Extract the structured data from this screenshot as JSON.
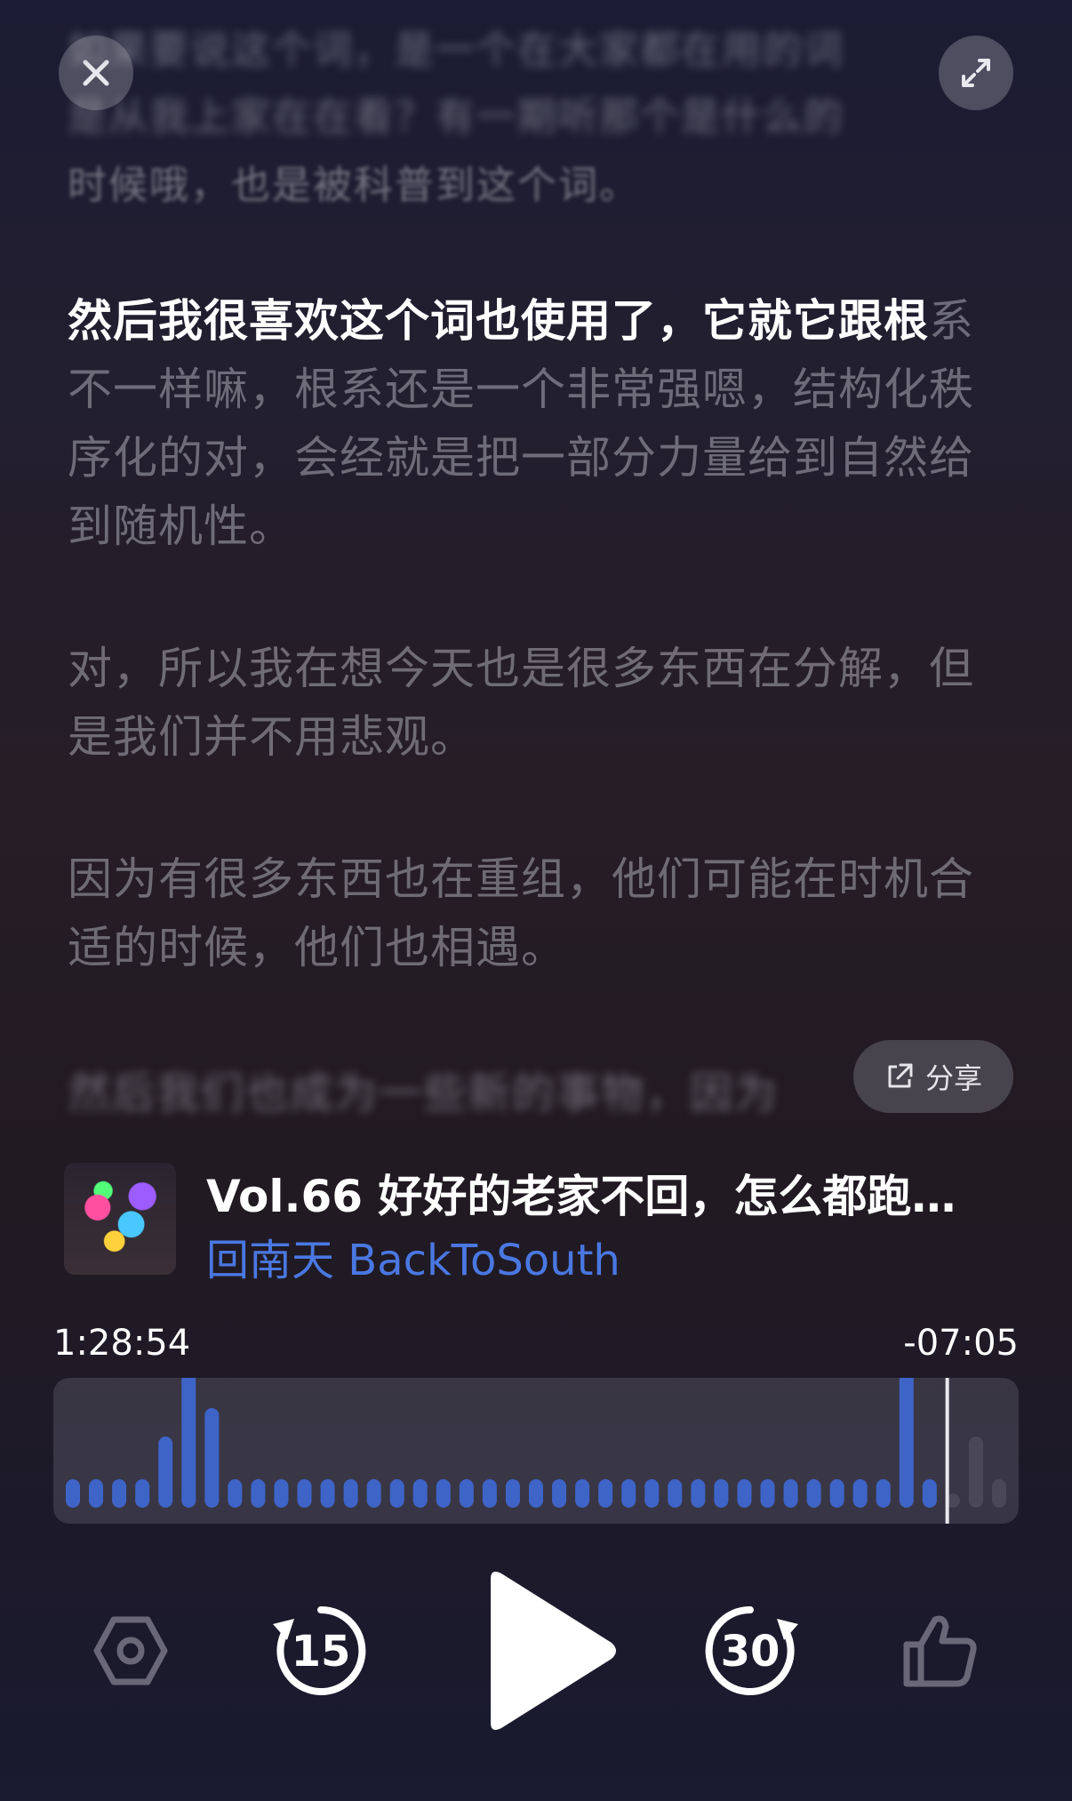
{
  "top_buttons": {
    "close_icon": "close-icon",
    "expand_icon": "expand-icon"
  },
  "blurred_text": {
    "line1": "如果要说这个词，是一个在大家都在用的词",
    "line2": "是从我上家在在看？有一期听那个是什么的",
    "line3": "时候哦，也是被科普到这个词。",
    "bottom": "然后我们也成为一些新的事物，因为"
  },
  "transcript": [
    {
      "highlight": "然后我很喜欢这个词也使用了，它就它跟根",
      "rest": "系不一样嘛，根系还是一个非常强嗯，结构化秩序化的对，会经就是把一部分力量给到自然给到随机性。"
    },
    {
      "highlight": "",
      "rest": "对，所以我在想今天也是很多东西在分解，但是我们并不用悲观。"
    },
    {
      "highlight": "",
      "rest": "因为有很多东西也在重组，他们可能在时机合适的时候，他们也相遇。"
    }
  ],
  "share": {
    "label": "分享",
    "icon": "share-icon"
  },
  "episode": {
    "title": "Vol.66 好好的老家不回，怎么都跑…",
    "podcast": "回南天 BackToSouth"
  },
  "progress": {
    "elapsed": "1:28:54",
    "remaining": "-07:05",
    "fraction": 0.926
  },
  "waveform": [
    2,
    2,
    2,
    2,
    5,
    10,
    7,
    2,
    2,
    2,
    2,
    2,
    2,
    2,
    2,
    2,
    2,
    2,
    2,
    2,
    2,
    2,
    2,
    2,
    2,
    2,
    2,
    2,
    2,
    2,
    2,
    2,
    2,
    2,
    2,
    2,
    10,
    2,
    1,
    5,
    2
  ],
  "colors": {
    "accent": "#4a78e2",
    "played": "#3e64c8",
    "unplayed": "#4a4858"
  },
  "controls": {
    "settings_icon": "hexagon-settings-icon",
    "back_label": "15",
    "play_icon": "play-icon",
    "forward_label": "30",
    "like_icon": "thumbs-up-icon"
  }
}
